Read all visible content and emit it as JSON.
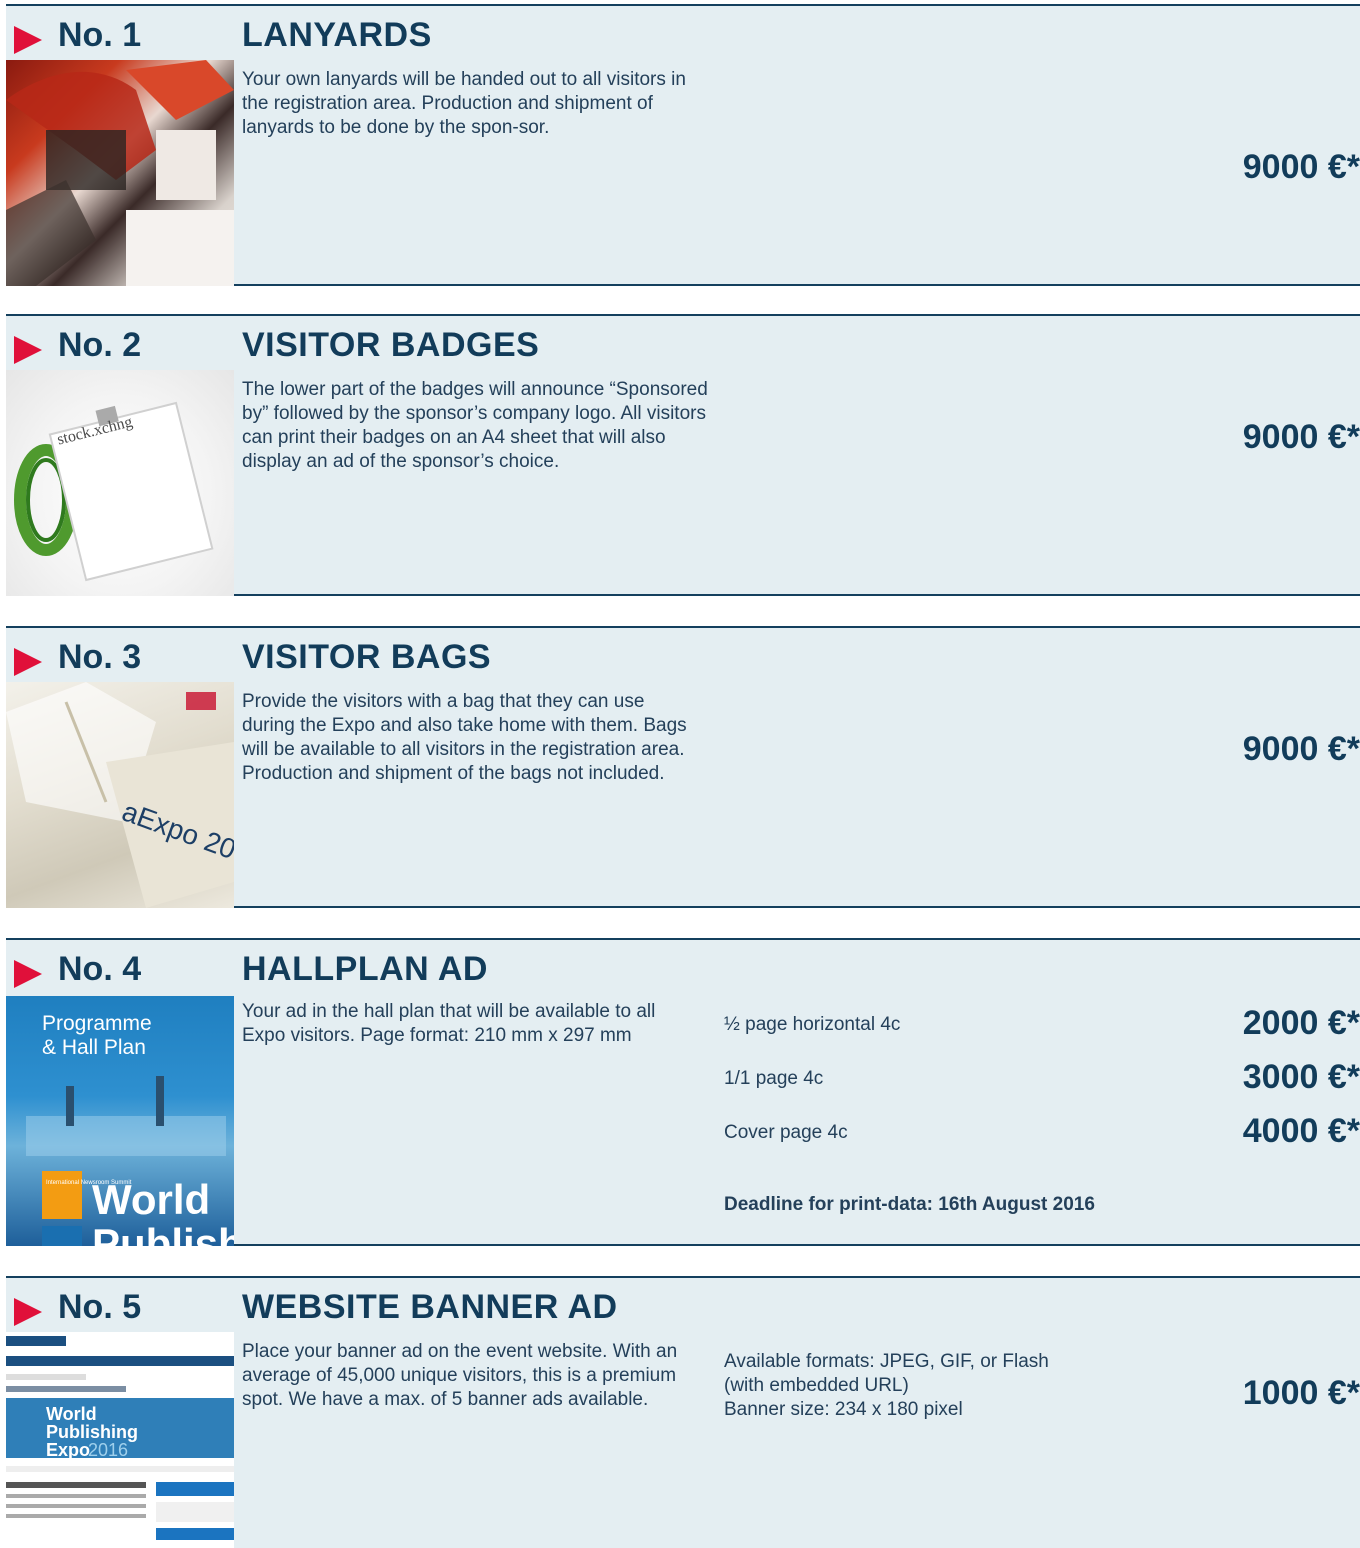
{
  "sections": [
    {
      "number": "No. 1",
      "title": "LANYARDS",
      "image_icon": "lanyards-photo",
      "description": "Your own lanyards will be handed out to all visitors in the registration area. Production and shipment of lanyards to be done by the spon-sor.",
      "price": "9000 €*"
    },
    {
      "number": "No. 2",
      "title": "VISITOR BADGES",
      "image_icon": "badge-photo",
      "image_text": "stock.xchng",
      "description": "The lower part of the badges will announce “Sponsored by” followed by the sponsor’s company logo. All visitors can print their badges on an A4 sheet that will also display an ad of the sponsor’s choice.",
      "price": "9000 €*"
    },
    {
      "number": "No. 3",
      "title": "VISITOR BAGS",
      "image_icon": "bags-photo",
      "image_text": "aExpo 20",
      "description": "Provide the visitors with a bag that they can use during the Expo and also take home with them. Bags will be available to all visitors in the registration area. Production and shipment of the bags not included.",
      "price": "9000 €*"
    },
    {
      "number": "No. 4",
      "title": "HALLPLAN AD",
      "image_icon": "hall-plan-cover",
      "image_text": {
        "heading1": "Programme",
        "heading2": "& Hall Plan",
        "badge": "International Newsroom Summit",
        "big": "World",
        "big2": "Publish"
      },
      "description": "Your ad in the hall plan that will be available to all Expo visitors. Page format: 210 mm x 297 mm",
      "options": [
        {
          "label": "½ page horizontal 4c",
          "price": "2000 €*"
        },
        {
          "label": "1/1 page 4c",
          "price": "3000 €*"
        },
        {
          "label": "Cover page 4c",
          "price": "4000 €*"
        }
      ],
      "deadline": "Deadline for print-data: 16th August 2016"
    },
    {
      "number": "No. 5",
      "title": "WEBSITE BANNER AD",
      "image_icon": "website-screenshot",
      "image_text": {
        "line1": "World",
        "line2": "Publishing",
        "line3": "Expo",
        "year": "2016"
      },
      "description": "Place your banner ad on the event website. With an average of 45,000 unique visitors, this is a premium spot. We have a max. of 5 banner ads available.",
      "formats": [
        "Available formats: JPEG, GIF, or Flash",
        "(with embedded URL)",
        "Banner size: 234 x 180 pixel"
      ],
      "price": "1000 €*"
    }
  ],
  "colors": {
    "accent": "#e0103a",
    "navy": "#123c5a",
    "panel": "#e4eef2"
  }
}
